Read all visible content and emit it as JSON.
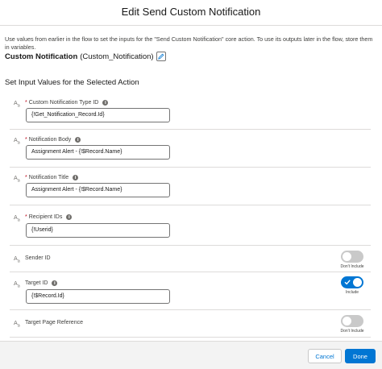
{
  "modal": {
    "title": "Edit Send Custom Notification"
  },
  "description": "Use values from earlier in the flow to set the inputs for the \"Send Custom Notification\" core action. To use its outputs later in the flow, store them in variables.",
  "action": {
    "name": "Custom Notification",
    "api_name": "(Custom_Notification)",
    "edit_icon": "pencil-icon"
  },
  "section_title": "Set Input Values for the Selected Action",
  "type_icon": {
    "main": "A",
    "sub": "a"
  },
  "required_marker": "*",
  "info_icon_glyph": "i",
  "fields": [
    {
      "label": "Custom Notification Type ID",
      "value": "{!Get_Notification_Record.Id}"
    },
    {
      "label": "Notification Body",
      "value": "Assignment Alert - {!$Record.Name}"
    },
    {
      "label": "Notification Title",
      "value": "Assignment Alert - {!$Record.Name}"
    },
    {
      "label": "Recipient IDs",
      "value": "{!Userid}"
    }
  ],
  "optional_fields": [
    {
      "label": "Sender ID",
      "toggle_label": "Don't Include",
      "included": false
    },
    {
      "label": "Target ID",
      "value": "{!$Record.Id}",
      "toggle_label": "Include",
      "included": true
    },
    {
      "label": "Target Page Reference",
      "toggle_label": "Don't Include",
      "included": false
    }
  ],
  "footer": {
    "cancel_label": "Cancel",
    "done_label": "Done"
  },
  "colors": {
    "brand": "#0176d3",
    "required": "#ba0517",
    "border": "#dddbda",
    "toggle_off": "#c9c9c9"
  }
}
